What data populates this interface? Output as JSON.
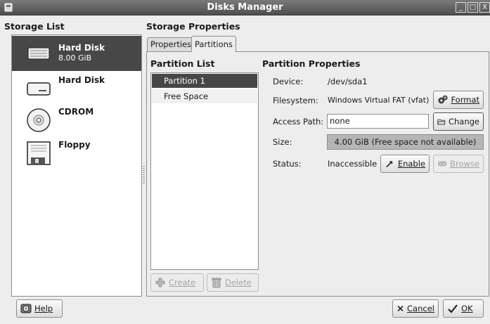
{
  "window": {
    "title": "Disks Manager",
    "controls": [
      "_",
      "□",
      "X"
    ]
  },
  "storage": {
    "heading": "Storage List",
    "devices": [
      {
        "name": "Hard Disk",
        "size": "8.00 GiB",
        "icon": "hard-disk-icon"
      },
      {
        "name": "Hard Disk",
        "size": "",
        "icon": "hard-disk-icon"
      },
      {
        "name": "CDROM",
        "size": "",
        "icon": "cdrom-icon"
      },
      {
        "name": "Floppy",
        "size": "",
        "icon": "floppy-icon"
      }
    ]
  },
  "properties": {
    "heading": "Storage Properties",
    "tabs": [
      {
        "label": "Properties"
      },
      {
        "label": "Partitions"
      }
    ],
    "partition_list": {
      "heading": "Partition List",
      "items": [
        "Partition 1",
        "Free Space"
      ],
      "create_label": "Create",
      "delete_label": "Delete"
    },
    "partition_props": {
      "heading": "Partition Properties",
      "device_label": "Device:",
      "device_value": "/dev/sda1",
      "filesystem_label": "Filesystem:",
      "filesystem_value": "Windows Virtual FAT (vfat)",
      "format_label": "Format",
      "access_label": "Access Path:",
      "access_value": "none",
      "change_label": "Change",
      "size_label": "Size:",
      "size_value": "4.00 GiB (Free space not available)",
      "status_label": "Status:",
      "status_value": "Inaccessible",
      "enable_label": "Enable",
      "browse_label": "Browse"
    }
  },
  "footer": {
    "help_label": "Help",
    "cancel_label": "Cancel",
    "ok_label": "OK"
  }
}
